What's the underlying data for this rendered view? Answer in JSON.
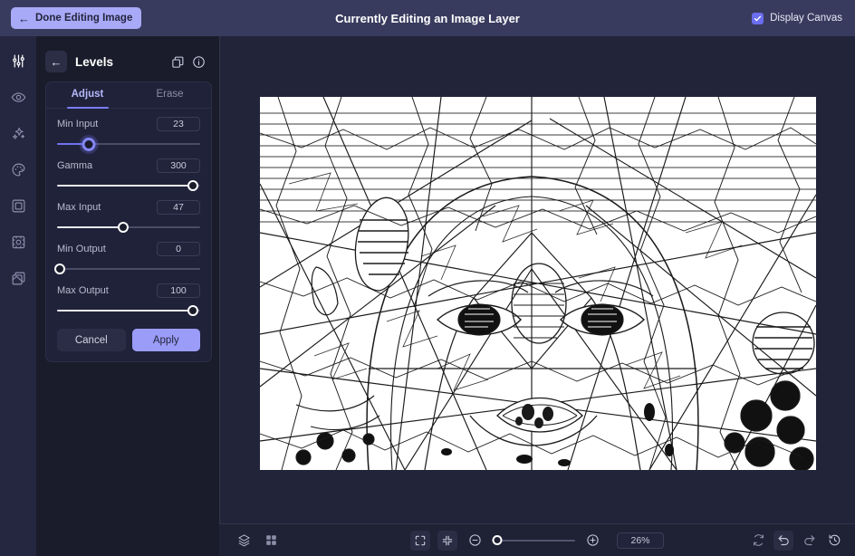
{
  "topbar": {
    "done_button": "Done Editing Image",
    "back_arrow_icon": "arrow-left-icon",
    "title": "Currently Editing an Image Layer",
    "display_canvas_label": "Display Canvas",
    "display_canvas_checked": true,
    "accent": "#a8a9f7",
    "bg": "#393b5e"
  },
  "rail": {
    "items": [
      {
        "icon": "adjustments-sliders-icon",
        "active": true
      },
      {
        "icon": "eye-icon",
        "active": false
      },
      {
        "icon": "sparkles-icon",
        "active": false
      },
      {
        "icon": "palette-icon",
        "active": false
      },
      {
        "icon": "frame-icon",
        "active": false
      },
      {
        "icon": "crop-transform-icon",
        "active": false
      },
      {
        "icon": "layers-copy-icon",
        "active": false
      }
    ]
  },
  "panel": {
    "back_icon": "arrow-left-icon",
    "title": "Levels",
    "duplicate_icon": "duplicate-layers-icon",
    "info_icon": "info-circle-icon",
    "tabs": [
      {
        "label": "Adjust",
        "active": true
      },
      {
        "label": "Erase",
        "active": false
      }
    ],
    "controls": [
      {
        "label": "Min Input",
        "value": "23",
        "percent": 22,
        "style": "accent"
      },
      {
        "label": "Gamma",
        "value": "300",
        "percent": 95,
        "style": "white"
      },
      {
        "label": "Max Input",
        "value": "47",
        "percent": 46,
        "style": "white"
      },
      {
        "label": "Min Output",
        "value": "0",
        "percent": 2,
        "style": "white"
      },
      {
        "label": "Max Output",
        "value": "100",
        "percent": 95,
        "style": "white"
      }
    ],
    "cancel_label": "Cancel",
    "apply_label": "Apply",
    "accent": "#9a9cf7"
  },
  "bottombar": {
    "left": [
      {
        "icon": "layers-stack-icon",
        "boxed": false
      },
      {
        "icon": "grid-four-squares-icon",
        "boxed": false
      }
    ],
    "center": [
      {
        "icon": "fit-to-screen-icon",
        "boxed": true
      },
      {
        "icon": "shrink-to-fit-icon",
        "boxed": true
      },
      {
        "icon": "zoom-out-minus-icon",
        "boxed": false
      },
      {
        "icon": "zoom-slider",
        "boxed": false
      },
      {
        "icon": "zoom-in-plus-icon",
        "boxed": false
      }
    ],
    "zoom_value": "26%",
    "zoom_percent": 8,
    "right": [
      {
        "icon": "reset-sync-icon",
        "boxed": false,
        "bright": false
      },
      {
        "icon": "undo-icon",
        "boxed": true,
        "bright": true
      },
      {
        "icon": "redo-icon",
        "boxed": false,
        "bright": false
      },
      {
        "icon": "history-clock-icon",
        "boxed": false,
        "bright": true
      }
    ]
  },
  "canvas": {
    "description": "black-and-white line-art sketch of a face on white background",
    "background": "#ffffff",
    "stage_bg": "#22243a"
  }
}
